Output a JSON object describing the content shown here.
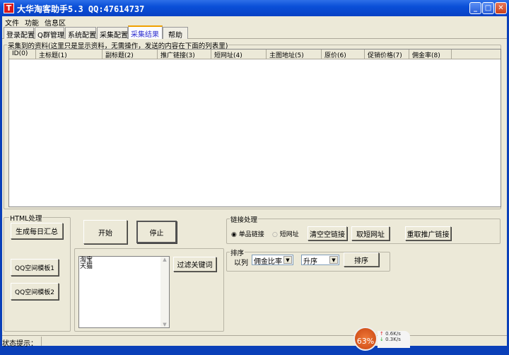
{
  "window": {
    "title": "大华淘客助手5.3 QQ:47614737",
    "icon": "T"
  },
  "menu": [
    "文件",
    "功能",
    "信息区"
  ],
  "tabs": [
    {
      "label": "登录配置"
    },
    {
      "label": "Q群管理"
    },
    {
      "label": "系统配置"
    },
    {
      "label": "采集配置"
    },
    {
      "label": "采集结果",
      "active": true
    },
    {
      "label": "帮助"
    }
  ],
  "results": {
    "group_label": "采集到的资料(这里只是显示资料，无需操作，发送的内容在下面的列表里)",
    "columns": [
      "ID(0)",
      "主标题(1)",
      "副标题(2)",
      "推广链接(3)",
      "短网址(4)",
      "主图地址(5)",
      "原价(6)",
      "促销价格(7)",
      "佣金率(8)"
    ]
  },
  "html": {
    "group_label": "HTML处理",
    "daily": "生成每日汇总",
    "tpl1": "QQ空间模板1",
    "tpl2": "QQ空间模板2"
  },
  "controls": {
    "start": "开始",
    "stop": "停止",
    "filter": "过滤关键词",
    "keywords": "淘宝\n天猫"
  },
  "link": {
    "group_label": "链接处理",
    "radio1": "单品链接",
    "radio2": "短网址",
    "clear": "清空空链接",
    "short": "取短网址",
    "refetch": "重取推广链接"
  },
  "sort": {
    "group_label": "排序",
    "by": "以列",
    "column": "佣金比率",
    "order": "升序",
    "button": "排序"
  },
  "status": {
    "label": "状态提示："
  },
  "tray": {
    "percent": "63%",
    "up": "0.6K/s",
    "down": "0.3K/s"
  }
}
